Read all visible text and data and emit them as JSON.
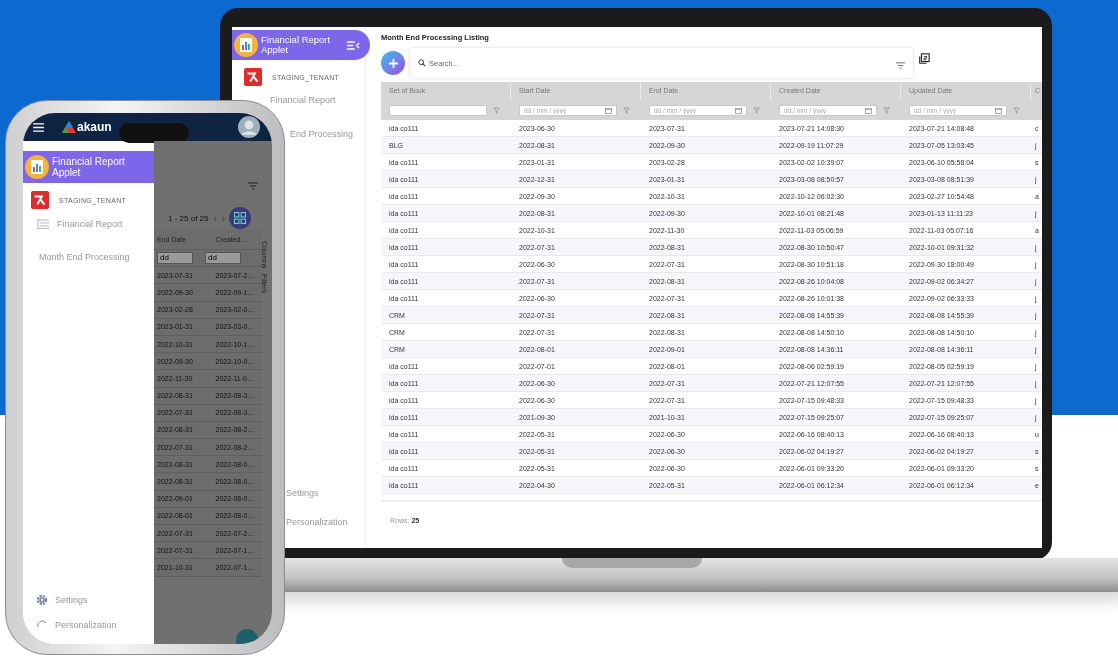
{
  "laptop": {
    "sidebar": {
      "app_title": "Financial Report Applet",
      "tenant": "STAGING_TENANT",
      "items": [
        "Financial Report",
        "End Processing"
      ],
      "footer_items": [
        "Settings",
        "Personalization"
      ]
    },
    "page_title": "Month End Processing Listing",
    "search": {
      "placeholder": "Search..."
    },
    "table": {
      "columns": [
        {
          "label": "Set of Book",
          "filter": {
            "kind": "text"
          }
        },
        {
          "label": "Start Date",
          "filter": {
            "kind": "date",
            "placeholder": "dd / mm / yyyy"
          }
        },
        {
          "label": "End Date",
          "filter": {
            "kind": "date",
            "placeholder": "dd / mm / yyyy"
          }
        },
        {
          "label": "Created Date",
          "filter": {
            "kind": "date",
            "placeholder": "dd / mm / yyyy"
          }
        },
        {
          "label": "Updated Date",
          "filter": {
            "kind": "date",
            "placeholder": "dd / mm / yyyy"
          }
        },
        {
          "label": "C",
          "filter": {
            "kind": "none"
          }
        }
      ],
      "rows": [
        [
          "ida co111",
          "2023-06-30",
          "2023-07-31",
          "2023-07-21 14:08:30",
          "2023-07-21 14:08:48",
          "c"
        ],
        [
          "BLG",
          "2022-08-31",
          "2022-09-30",
          "2022-09-19 11:07:29",
          "2023-07-05 13:03:45",
          "j"
        ],
        [
          "ida co111",
          "2023-01-31",
          "2023-02-28",
          "2023-02-02 10:39:07",
          "2023-06-10 05:58:04",
          "s"
        ],
        [
          "ida co111",
          "2022-12-31",
          "2023-01-31",
          "2023-03-08 08:50:57",
          "2023-03-08 08:51:39",
          "j"
        ],
        [
          "ida co111",
          "2022-09-30",
          "2022-10-31",
          "2022-10-12 06:02:30",
          "2023-02-27 10:54:48",
          "a"
        ],
        [
          "ida co111",
          "2022-08-31",
          "2022-09-30",
          "2022-10-01 08:21:48",
          "2023-01-13 11:11:23",
          "j"
        ],
        [
          "ida co111",
          "2022-10-31",
          "2022-11-30",
          "2022-11-03 05:06:59",
          "2022-11-03 05:07:16",
          "a"
        ],
        [
          "ida co111",
          "2022-07-31",
          "2022-08-31",
          "2022-08-30 10:50:47",
          "2022-10-01 09:31:32",
          "j"
        ],
        [
          "ida co111",
          "2022-06-30",
          "2022-07-31",
          "2022-08-30 10:51:18",
          "2022-09-30 18:00:49",
          "j"
        ],
        [
          "ida co111",
          "2022-07-31",
          "2022-08-31",
          "2022-08-26 10:04:08",
          "2022-09-02 06:34:27",
          "j"
        ],
        [
          "ida co111",
          "2022-06-30",
          "2022-07-31",
          "2022-08-26 10:01:38",
          "2022-09-02 06:33:33",
          "j"
        ],
        [
          "CRM",
          "2022-07-31",
          "2022-08-31",
          "2022-08-08 14:55:39",
          "2022-08-08 14:55:39",
          "j"
        ],
        [
          "CRM",
          "2022-07-31",
          "2022-08-31",
          "2022-08-08 14:50:10",
          "2022-08-08 14:50:10",
          "j"
        ],
        [
          "CRM",
          "2022-08-01",
          "2022-09-01",
          "2022-08-08 14:36:11",
          "2022-08-08 14:36:11",
          "j"
        ],
        [
          "ida co111",
          "2022-07-01",
          "2022-08-01",
          "2022-08-06 02:59:19",
          "2022-08-05 02:59:19",
          "j"
        ],
        [
          "ida co111",
          "2022-06-30",
          "2022-07-31",
          "2022-07-21 12:07:55",
          "2022-07-21 12:07:55",
          "j"
        ],
        [
          "ida co111",
          "2022-06-30",
          "2022-07-31",
          "2022-07-15 09:48:33",
          "2022-07-15 09:48:33",
          "j"
        ],
        [
          "ida co111",
          "2021-09-30",
          "2021-10-31",
          "2022-07-15 09:25:07",
          "2022-07-15 09:25:07",
          "j"
        ],
        [
          "ida co111",
          "2022-05-31",
          "2022-06-30",
          "2022-06-16 08:40:13",
          "2022-06-16 08:40:13",
          "u"
        ],
        [
          "ida co111",
          "2022-05-31",
          "2022-06-30",
          "2022-06-02 04:19:27",
          "2022-06-02 04:19:27",
          "s"
        ],
        [
          "ida co111",
          "2022-05-31",
          "2022-06-30",
          "2022-06-01 09:33:20",
          "2022-06-01 09:33:20",
          "s"
        ],
        [
          "ida co111",
          "2022-04-30",
          "2022-05-31",
          "2022-06-01 06:12:34",
          "2022-06-01 06:12:34",
          "e"
        ]
      ],
      "footer": {
        "label": "Rows:",
        "count": "25"
      }
    }
  },
  "phone": {
    "brand": "akaun",
    "drawer": {
      "app_title": "Financial Report Applet",
      "tenant": "STAGING_TENANT",
      "items": [
        "Financial Report",
        "Month End Processing"
      ],
      "footer_items": [
        "Settings",
        "Personalization"
      ]
    },
    "behind": {
      "pager": "1 - 25 of 25",
      "pager_prev": "‹",
      "pager_next": "›",
      "columns": [
        "End Date",
        "Created…"
      ],
      "filter_placeholders": [
        "dd",
        "dd"
      ],
      "side_tabs": [
        "Columns",
        "Filters"
      ],
      "rows": [
        [
          "2023-07-31",
          "2023-07-2…"
        ],
        [
          "2022-09-30",
          "2022-09-1…"
        ],
        [
          "2023-02-28",
          "2023-02-0…"
        ],
        [
          "2023-01-31",
          "2023-03-0…"
        ],
        [
          "2022-10-31",
          "2022-10-1…"
        ],
        [
          "2022-09-30",
          "2022-10-0…"
        ],
        [
          "2022-11-30",
          "2022-11-0…"
        ],
        [
          "2022-08-31",
          "2022-08-3…"
        ],
        [
          "2022-07-31",
          "2022-08-3…"
        ],
        [
          "2022-08-31",
          "2022-08-2…"
        ],
        [
          "2022-07-31",
          "2022-08-2…"
        ],
        [
          "2022-08-31",
          "2022-08-0…"
        ],
        [
          "2022-08-31",
          "2022-08-0…"
        ],
        [
          "2022-09-01",
          "2022-08-0…"
        ],
        [
          "2022-08-01",
          "2022-08-0…"
        ],
        [
          "2022-07-31",
          "2022-07-2…"
        ],
        [
          "2022-07-31",
          "2022-07-1…"
        ],
        [
          "2021-10-31",
          "2022-07-1…"
        ]
      ]
    }
  }
}
